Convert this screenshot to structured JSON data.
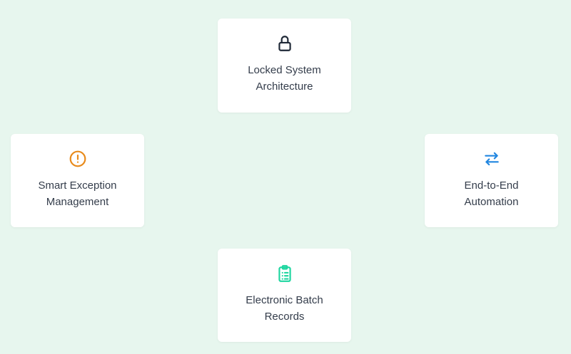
{
  "cards": [
    {
      "label": "Locked System\nArchitecture",
      "icon": "lock-icon",
      "color": "#1f2937"
    },
    {
      "label": "Smart Exception\nManagement",
      "icon": "alert-circle-icon",
      "color": "#e88a1a"
    },
    {
      "label": "End-to-End\nAutomation",
      "icon": "arrows-swap-icon",
      "color": "#2186e0"
    },
    {
      "label": "Electronic Batch\nRecords",
      "icon": "clipboard-list-icon",
      "color": "#1fd6a0"
    }
  ]
}
